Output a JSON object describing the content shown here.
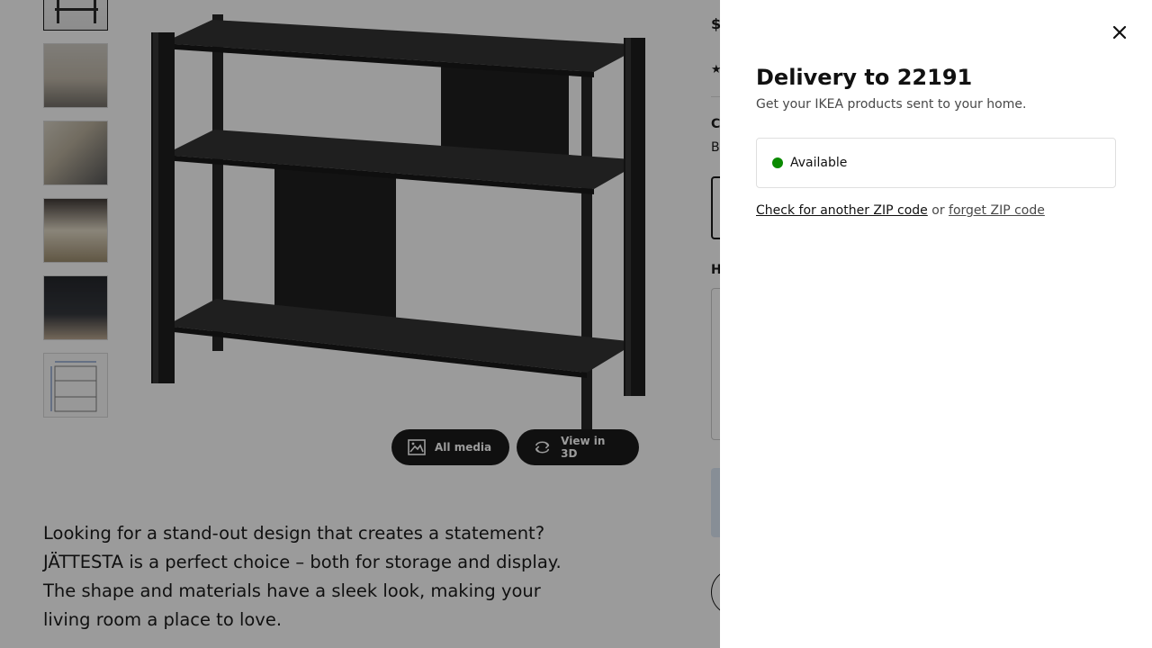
{
  "product_page": {
    "price_peek": "$",
    "color_label_peek": "C",
    "color_value_peek": "B",
    "how_peek": "H",
    "media_buttons": {
      "all_media": "All media",
      "view_3d": "View in 3D"
    },
    "description": "Looking for a stand-out design that creates a statement? JÄTTESTA is a perfect choice – both for storage and display. The shape and materials have a sleek look, making your living room a place to love."
  },
  "delivery_sheet": {
    "title": "Delivery to 22191",
    "subtitle": "Get your IKEA products sent to your home.",
    "availability": {
      "status": "Available",
      "status_color": "#0a8a00"
    },
    "check_link": "Check for another ZIP code",
    "or_text": "or",
    "forget_link": "forget ZIP code",
    "close_icon": "close-icon"
  }
}
